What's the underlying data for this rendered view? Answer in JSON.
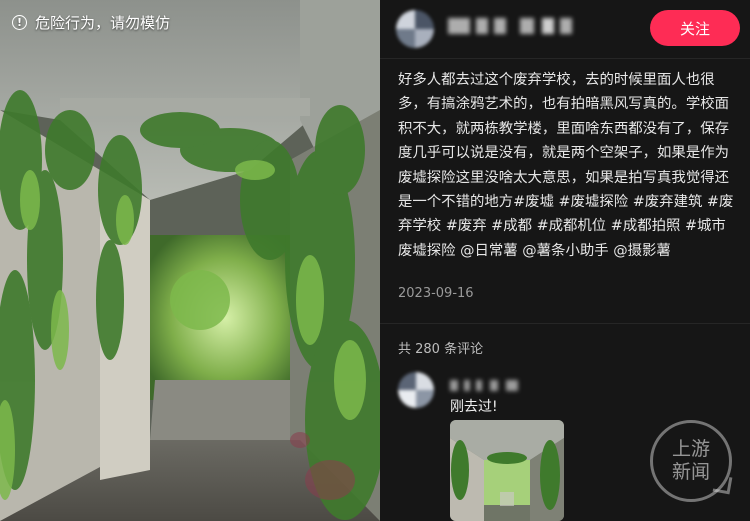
{
  "warning": {
    "text": "危险行为，请勿模仿",
    "icon": "exclamation-circle-icon"
  },
  "header": {
    "follow_label": "关注"
  },
  "post": {
    "description": "好多人都去过这个废弃学校，去的时候里面人也很多，有搞涂鸦艺术的，也有拍暗黑风写真的。学校面积不大，就两栋教学楼，里面啥东西都没有了，保存度几乎可以说是没有，就是两个空架子，如果是作为废墟探险这里没啥太大意思，如果是拍写真我觉得还是一个不错的地方#废墟 #废墟探险 #废弃建筑 #废弃学校 #废弃 #成都 #成都机位 #成都拍照 #城市废墟探险 @日常薯 @薯条小助手 @摄影薯",
    "date": "2023-09-16"
  },
  "comments": {
    "count_label": "共 280 条评论",
    "items": [
      {
        "text": "刚去过!"
      }
    ]
  },
  "watermark": {
    "line1": "上游",
    "line2": "新闻"
  },
  "colors": {
    "follow": "#fe2c55",
    "panel_bg": "#161616"
  }
}
